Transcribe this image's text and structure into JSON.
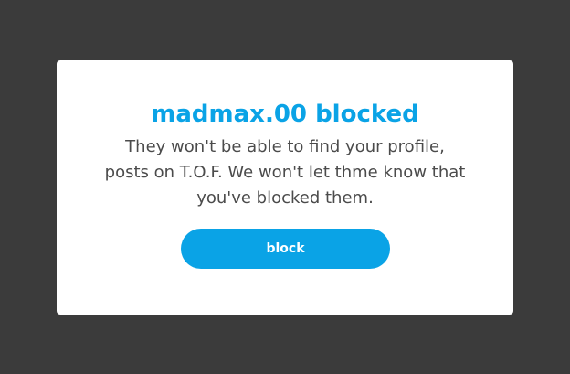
{
  "dialog": {
    "title": "madmax.00 blocked",
    "message": "They won't be able to find your profile, posts on T.O.F. We won't let thme know that you've blocked them.",
    "block_button_label": "block"
  },
  "colors": {
    "backdrop": "#3b3b3b",
    "accent": "#0aa3e6",
    "text": "#4b4b4b",
    "dialog_background": "#ffffff"
  }
}
